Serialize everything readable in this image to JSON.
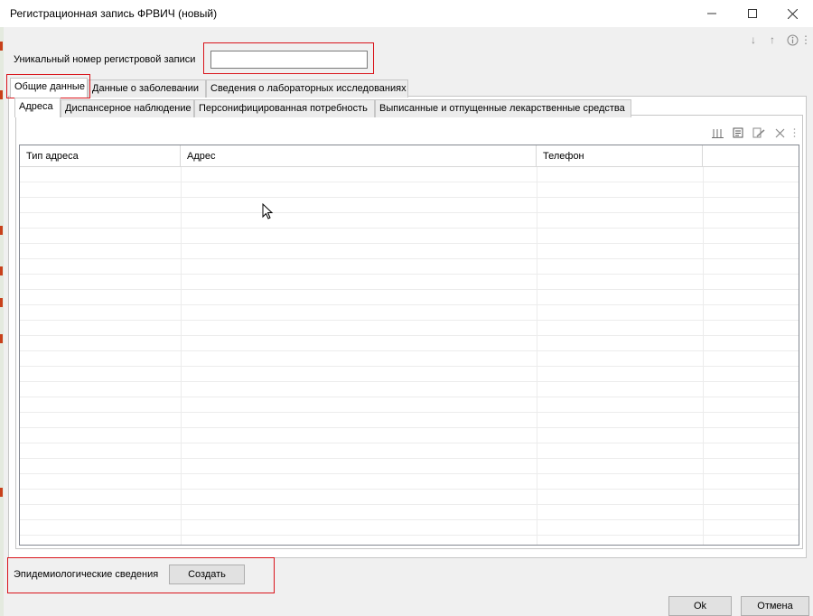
{
  "window": {
    "title": "Регистрационная запись ФРВИЧ (новый)",
    "controls": {
      "minimize": "—",
      "maximize": "☐",
      "close": "✕"
    }
  },
  "mini_toolbar": {
    "down": "↓",
    "up": "↑",
    "info": "ⓘ",
    "more": "⋮"
  },
  "unique_number": {
    "label": "Уникальный номер регистровой записи",
    "value": ""
  },
  "outer_tabs": [
    {
      "label": "Общие данные",
      "active": true
    },
    {
      "label": "Данные о заболевании",
      "active": false
    },
    {
      "label": "Сведения о лабораторных исследованиях",
      "active": false
    }
  ],
  "inner_tabs": [
    {
      "label": "Адреса",
      "active": true
    },
    {
      "label": "Диспансерное наблюдение",
      "active": false
    },
    {
      "label": "Персонифицированная потребность",
      "active": false
    },
    {
      "label": "Выписанные и отпущенные лекарственные средства",
      "active": false
    }
  ],
  "grid_toolbar": {
    "sort_icon": "sort-icon",
    "details_icon": "details-icon",
    "edit_icon": "edit-icon",
    "delete_icon": "delete-icon"
  },
  "grid": {
    "columns": [
      "Тип адреса",
      "Адрес",
      "Телефон",
      ""
    ],
    "rows": []
  },
  "bottom": {
    "epidemiology_label": "Эпидемиологические сведения",
    "create_button": "Создать",
    "ok_button": "Ok",
    "cancel_button": "Отмена"
  },
  "colors": {
    "highlight_box": "#d9141b",
    "window_bg": "#f0f0f0",
    "panel_bg": "#ffffff"
  }
}
